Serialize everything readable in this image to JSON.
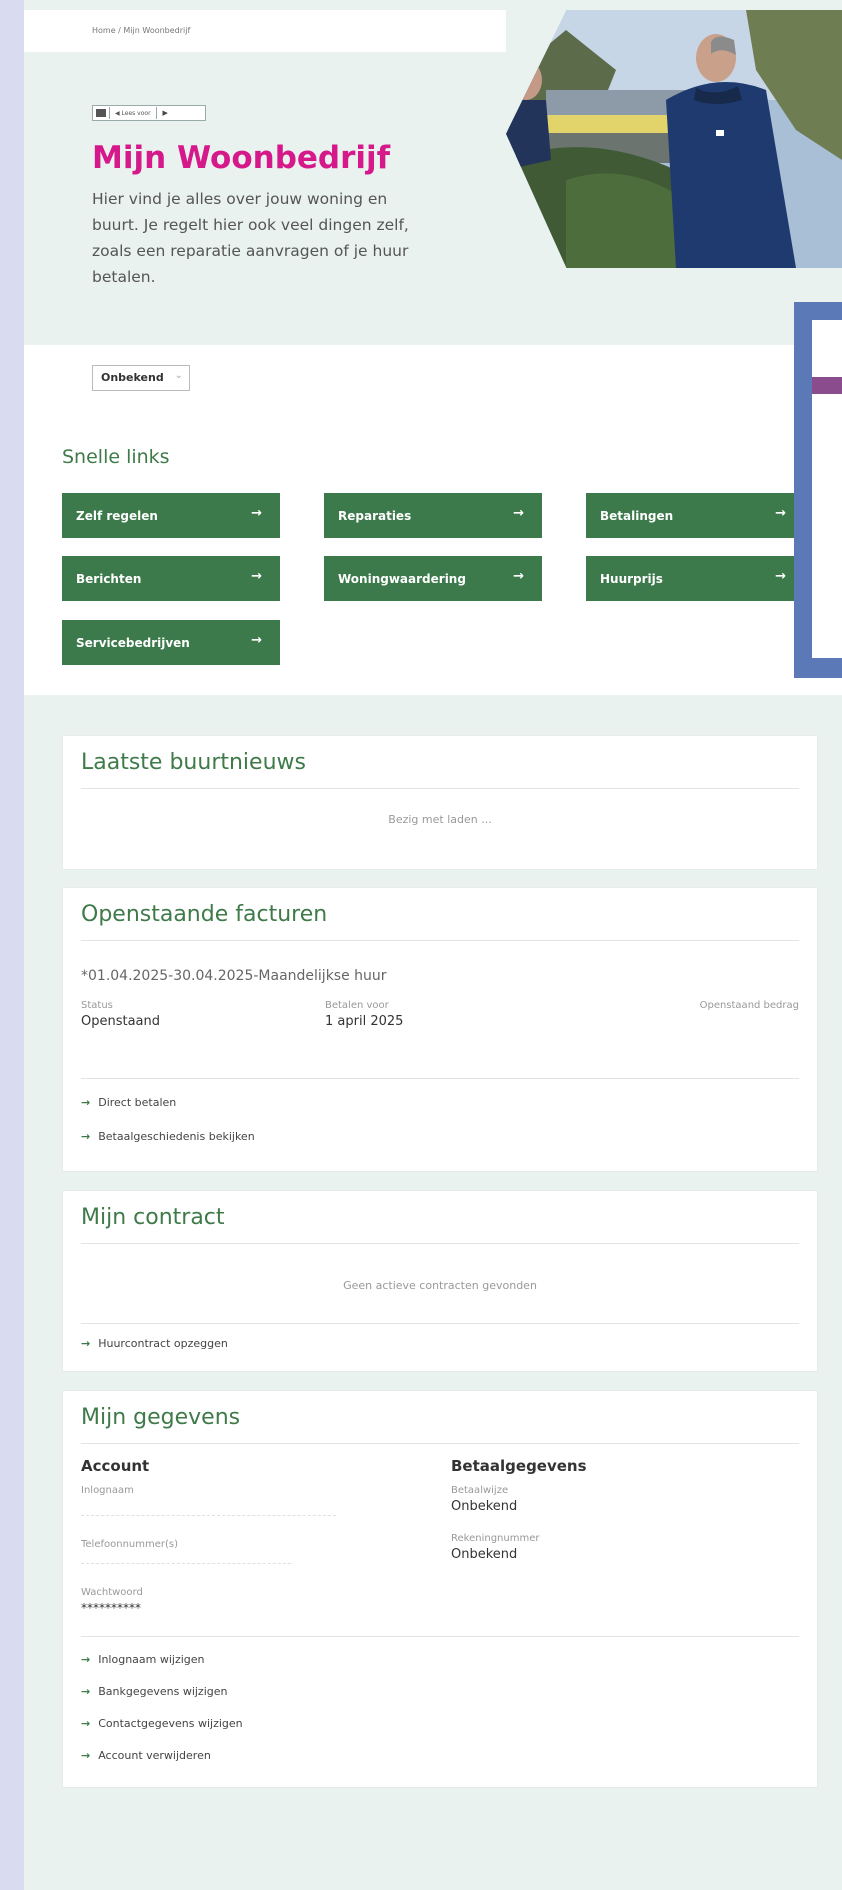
{
  "breadcrumb": {
    "home": "Home",
    "sep": "/",
    "current": "Mijn Woonbedrijf"
  },
  "readspeaker": {
    "label": "Lees voor"
  },
  "hero": {
    "title": "Mijn Woonbedrijf",
    "intro": "Hier vind je alles over jouw woning en buurt. Je regelt hier ook veel dingen zelf, zoals een reparatie aanvragen of je huur betalen."
  },
  "language_select": {
    "value": "Onbekend"
  },
  "quick_links": {
    "title": "Snelle links",
    "items": [
      {
        "label": "Zelf regelen"
      },
      {
        "label": "Reparaties"
      },
      {
        "label": "Betalingen"
      },
      {
        "label": "Berichten"
      },
      {
        "label": "Woningwaardering"
      },
      {
        "label": "Huurprijs"
      },
      {
        "label": "Servicebedrijven"
      }
    ]
  },
  "news": {
    "title": "Laatste buurtnieuws",
    "loading": "Bezig met laden ..."
  },
  "invoices": {
    "title": "Openstaande facturen",
    "invoice_name": "*01.04.2025-30.04.2025-Maandelijkse huur",
    "status_label": "Status",
    "status_value": "Openstaand",
    "due_label": "Betalen voor",
    "due_value": "1 april 2025",
    "amount_label": "Openstaand bedrag",
    "links": [
      "Direct betalen",
      "Betaalgeschiedenis bekijken"
    ]
  },
  "contract": {
    "title": "Mijn contract",
    "empty": "Geen actieve contracten gevonden",
    "links": [
      "Huurcontract opzeggen"
    ]
  },
  "details": {
    "title": "Mijn gegevens",
    "account": {
      "heading": "Account",
      "username_label": "Inlognaam",
      "phone_label": "Telefoonnummer(s)",
      "password_label": "Wachtwoord",
      "password_value": "**********"
    },
    "payment": {
      "heading": "Betaalgegevens",
      "method_label": "Betaalwijze",
      "method_value": "Onbekend",
      "account_label": "Rekeningnummer",
      "account_value": "Onbekend"
    },
    "links": [
      "Inlognaam wijzigen",
      "Bankgegevens wijzigen",
      "Contactgegevens wijzigen",
      "Account verwijderen"
    ]
  },
  "colors": {
    "brand_pink": "#d6198a",
    "brand_green": "#3c7a4b",
    "panel_bg": "#e9f2ee",
    "overlay_blue": "#5b79b6"
  }
}
